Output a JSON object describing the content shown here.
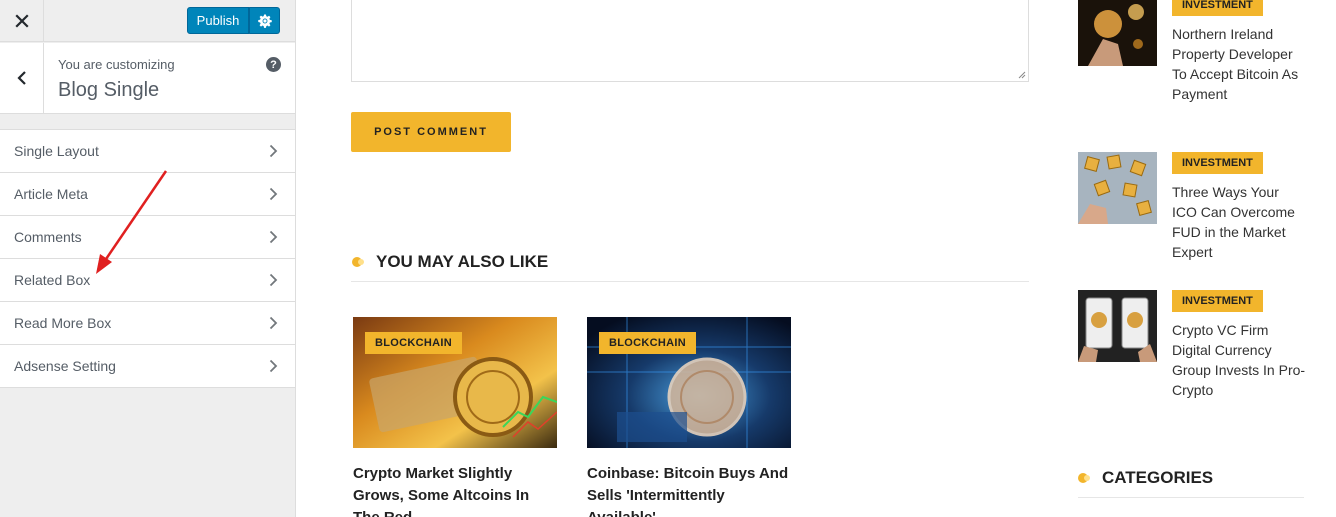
{
  "header": {
    "publish_label": "Publish",
    "customizing_label": "You are customizing",
    "section_title": "Blog Single",
    "help_glyph": "?"
  },
  "icons": {
    "close": "close-icon",
    "settings": "gear-icon",
    "back": "chevron-left-icon",
    "help": "help-icon",
    "chevron": "chevron-right-icon"
  },
  "colors": {
    "accent": "#f2b52c",
    "wp_blue": "#0085ba",
    "annotation_arrow": "#e02020"
  },
  "menu": {
    "items": [
      {
        "label": "Single Layout"
      },
      {
        "label": "Article Meta"
      },
      {
        "label": "Comments"
      },
      {
        "label": "Related Box"
      },
      {
        "label": "Read More Box"
      },
      {
        "label": "Adsense Setting"
      }
    ]
  },
  "main": {
    "post_comment_label": "POST COMMENT",
    "related_title": "YOU MAY ALSO LIKE",
    "related": [
      {
        "badge": "BLOCKCHAIN",
        "title": "Crypto Market Slightly Grows, Some Altcoins In The Red"
      },
      {
        "badge": "BLOCKCHAIN",
        "title": "Coinbase: Bitcoin Buys And Sells 'Intermittently Available'"
      }
    ]
  },
  "side": {
    "posts": [
      {
        "badge": "INVESTMENT",
        "title": "Northern Ireland Property Developer To Accept Bitcoin As Payment"
      },
      {
        "badge": "INVESTMENT",
        "title": "Three Ways Your ICO Can Overcome FUD in the Market Expert"
      },
      {
        "badge": "INVESTMENT",
        "title": "Crypto VC Firm Digital Currency Group Invests In Pro-Crypto"
      }
    ],
    "categories_title": "CATEGORIES"
  }
}
